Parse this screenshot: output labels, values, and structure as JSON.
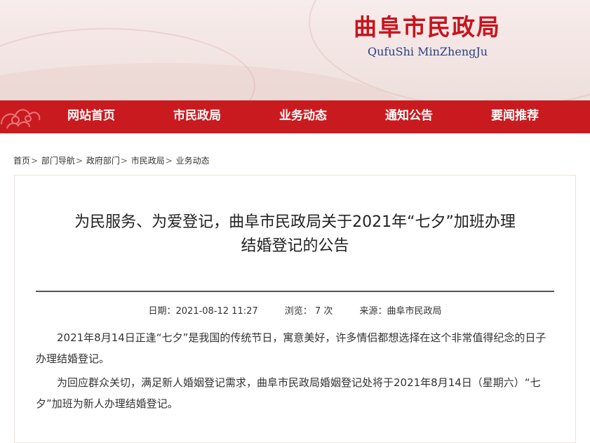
{
  "header": {
    "title": "曲阜市民政局",
    "subtitle": "QufuShi MinZhengJu"
  },
  "nav": {
    "items": [
      "网站首页",
      "市民政局",
      "业务动态",
      "通知公告",
      "要闻推荐"
    ]
  },
  "breadcrumb": [
    "首页",
    "部门导航",
    "政府部门",
    "市民政局",
    "业务动态"
  ],
  "article": {
    "title_line1": "为民服务、为爱登记，曲阜市民政局关于2021年“七夕”加班办理",
    "title_line2": "结婚登记的公告",
    "date": "日期：2021-08-12 11:27",
    "views": "浏览： 7 次",
    "source": "来源：曲阜市民政局",
    "paragraphs": [
      "2021年8月14日正逢“七夕”是我国的传统节日，寓意美好，许多情侣都想选择在这个非常值得纪念的日子办理结婚登记。",
      "为回应群众关切，满足新人婚姻登记需求，曲阜市民政局婚姻登记处将于2021年8月14日（星期六）“七夕”加班为新人办理结婚登记。"
    ]
  },
  "colors": {
    "brand_red": "#c91b1f",
    "title_red": "#c8141e",
    "subtitle_blue": "#2a3f86"
  }
}
